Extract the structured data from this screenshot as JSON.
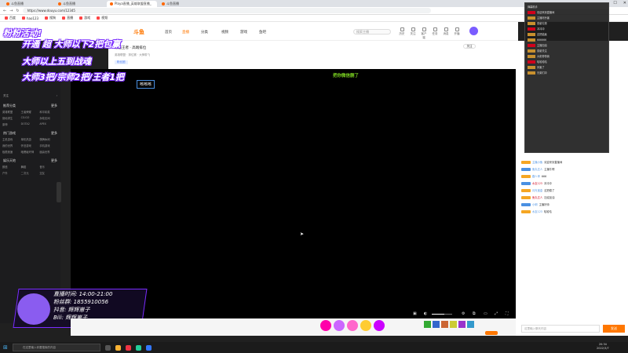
{
  "browser": {
    "tabs": [
      "斗鱼直播",
      "斗鱼直播",
      "Playa直播_英雄联盟直播_",
      "斗鱼直播"
    ],
    "url": "https://www.douyu.com/12345",
    "bookmarks": [
      "百度",
      "hao123",
      "搜狗",
      "直播",
      "游戏",
      "视频",
      "音乐",
      "新闻",
      "其他"
    ]
  },
  "header": {
    "logo": "斗鱼",
    "nav": [
      "首页",
      "直播",
      "分类",
      "视频",
      "游戏",
      "鱼吧"
    ],
    "search_placeholder": "搜索主播",
    "icons": [
      {
        "name": "history-icon",
        "label": "历史"
      },
      {
        "name": "follow-icon",
        "label": "关注"
      },
      {
        "name": "app-icon",
        "label": "客户端"
      },
      {
        "name": "task-icon",
        "label": "任务"
      },
      {
        "name": "message-icon",
        "label": "消息"
      },
      {
        "name": "start-live-icon",
        "label": "开播"
      }
    ]
  },
  "sidebar": {
    "sections": [
      {
        "title": "推荐分类",
        "items": [
          "英雄联盟",
          "王者荣耀",
          "和平精英",
          "绝地求生",
          "CS:GO",
          "永劫无间",
          "原神",
          "DOTA2",
          "APEX"
        ]
      },
      {
        "title": "热门游戏",
        "items": [
          "主机游戏",
          "单机热游",
          "棋牌休闲",
          "我的世界",
          "怀旧游戏",
          "手机游戏",
          "极限竞速",
          "暗黑破坏神",
          "魔兽世界"
        ]
      },
      {
        "title": "娱乐天地",
        "items": [
          "颜值",
          "舞蹈",
          "音乐",
          "户外",
          "二次元",
          "交友",
          "脱口秀",
          "美食",
          "体育"
        ]
      }
    ],
    "top_items": [
      "关注",
      "推荐",
      "游戏",
      "直播"
    ]
  },
  "promo": {
    "line1": "粉粉活动!",
    "line2": "开通 超 大师以下2把包赢",
    "line3": "大师以上五到战魂",
    "line4": "大师3把/宗师2把/王者1把"
  },
  "room": {
    "title": "最强王者 · 高端排位",
    "tags": [
      "英雄联盟",
      "排位赛",
      "大神带飞"
    ],
    "streamer_badge": "粉丝团",
    "follow": "关注"
  },
  "player": {
    "overlay_left": "咳咳咳",
    "overlay_right": "把你微信删了",
    "schedule": [
      "直播时间: 14:00-21:00",
      "粉丝群: 1855910056",
      "抖音: 辉辉崽子",
      "Bili: 辉辉崽子"
    ]
  },
  "chat": {
    "messages": [
      {
        "user": "主播小鱼",
        "text": "欢迎来到直播间"
      },
      {
        "user": "鱼丸达人",
        "text": "主播牛啊"
      },
      {
        "user": "路人甲",
        "text": "666"
      },
      {
        "user": "水友123",
        "text": "冲冲冲"
      },
      {
        "user": "月光宝盒",
        "text": "这把稳了"
      },
      {
        "user": "鱼丸达人",
        "text": "加油加油"
      },
      {
        "user": "小明",
        "text": "主播好帅"
      },
      {
        "user": "水友123",
        "text": "哈哈哈"
      }
    ],
    "input_placeholder": "这里输入聊天内容",
    "send": "发送"
  },
  "overlay_window": {
    "title": "弹幕助手",
    "messages": [
      "欢迎来到直播间",
      "主播好厉害",
      "感谢礼物",
      "冲冲冲",
      "这把能赢",
      "666666",
      "主播加油",
      "感谢关注",
      "大佬带带我",
      "哈哈哈哈",
      "厉害了",
      "兄弟们冲"
    ]
  },
  "taskbar": {
    "search": "在这里输入你要搜索的内容",
    "time": "20:34",
    "date": "2022/3/7"
  },
  "colors": {
    "accent": "#ff7700",
    "promo_outline": "#7a2cff",
    "overlay_right": "#7bd321"
  }
}
